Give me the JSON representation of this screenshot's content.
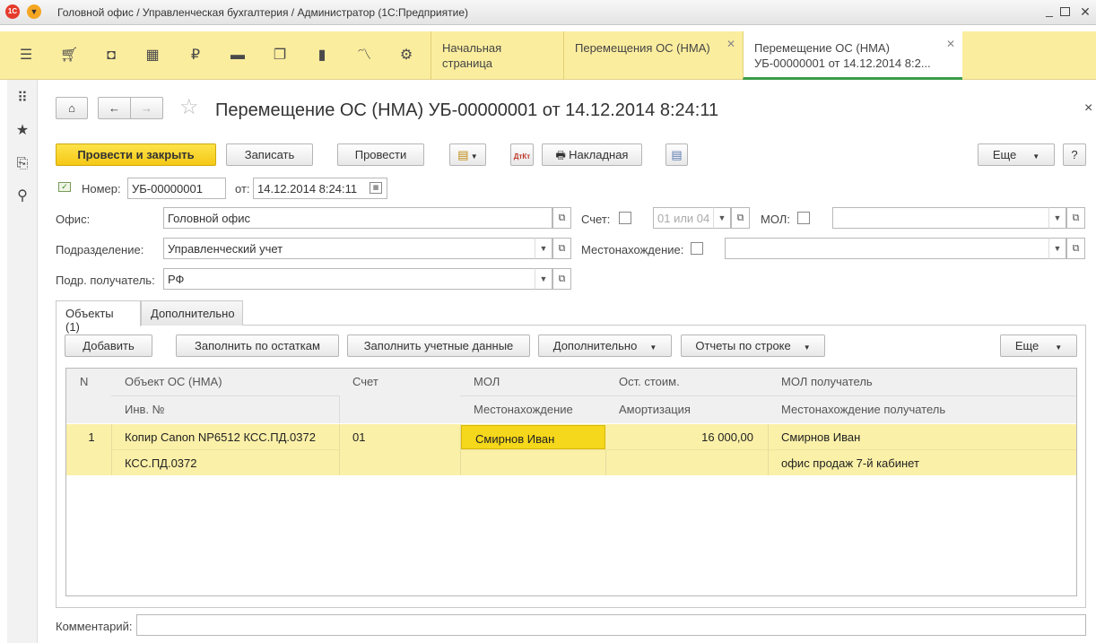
{
  "window": {
    "title": "Головной офис / Управленческая бухгалтерия / Администратор  (1С:Предприятие)"
  },
  "sections": {
    "icons": [
      "menu-icon",
      "cart-icon",
      "bag-icon",
      "grid-icon",
      "ruble-icon",
      "truck-icon",
      "documents-icon",
      "bar-chart-icon",
      "trend-icon",
      "gear-icon"
    ],
    "tabs": [
      {
        "label": "Начальная страница"
      },
      {
        "label": "Перемещения ОС (НМА)"
      },
      {
        "label": "Перемещение ОС (НМА)",
        "label2": "УБ-00000001 от 14.12.2014 8:2..."
      }
    ]
  },
  "document": {
    "title": "Перемещение ОС (НМА) УБ-00000001 от 14.12.2014 8:24:11",
    "close": "×"
  },
  "toolbar": {
    "post_close": "Провести и закрыть",
    "save": "Записать",
    "post": "Провести",
    "invoice": "Накладная",
    "more": "Еще",
    "help": "?"
  },
  "header": {
    "number_label": "Номер:",
    "number_value": "УБ-00000001",
    "date_label": "от:",
    "date_value": "14.12.2014  8:24:11",
    "office_label": "Офис:",
    "office_value": "Головной офис",
    "account_label": "Счет:",
    "account_placeholder": "01 или 04",
    "mol_label": "МОЛ:",
    "division_label": "Подразделение:",
    "division_value": "Управленческий учет",
    "location_label": "Местонахождение:",
    "recipient_label": "Подр. получатель:",
    "recipient_value": "РФ"
  },
  "form_tabs": [
    "Объекты (1)",
    "Дополнительно"
  ],
  "objects_toolbar": {
    "add": "Добавить",
    "fill_balances": "Заполнить по остаткам",
    "fill_accounting": "Заполнить учетные данные",
    "additional": "Дополнительно",
    "row_reports": "Отчеты по строке",
    "more": "Еще"
  },
  "table": {
    "headers_top": [
      "N",
      "Объект ОС (НМА)",
      "Счет",
      "МОЛ",
      "Ост. стоим.",
      "МОЛ получатель"
    ],
    "headers_bottom": [
      "",
      "Инв. №",
      "",
      "Местонахождение",
      "Амортизация",
      "Местонахождение получатель"
    ],
    "rows": [
      {
        "n": "1",
        "object": "Копир Canon NP6512 КСС.ПД.0372",
        "inv": "КСС.ПД.0372",
        "account": "01",
        "mol": "Смирнов Иван",
        "location": "",
        "residual": "16 000,00",
        "depreciation": "",
        "mol_recipient": "Смирнов Иван",
        "location_recipient": "офис продаж 7-й кабинет"
      }
    ]
  },
  "comment": {
    "label": "Комментарий:",
    "value": ""
  },
  "colors": {
    "accent": "#f5c815",
    "section_bg": "#fbed9e",
    "row_highlight": "#fbf0a8",
    "cell_selected": "#f5d71b"
  }
}
